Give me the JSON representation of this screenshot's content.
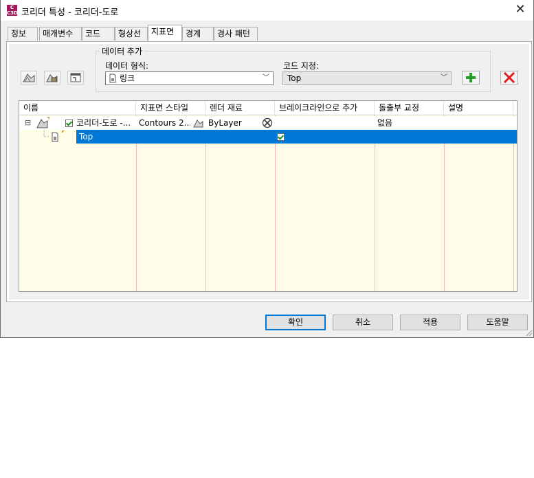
{
  "window": {
    "app_icon_text": "C\nC3D",
    "title": "코리더 특성 - 코리더-도로",
    "close_glyph": "✕"
  },
  "tabs": [
    {
      "label": "정보",
      "active": false
    },
    {
      "label": "매개변수",
      "active": false
    },
    {
      "label": "코드",
      "active": false
    },
    {
      "label": "형상선",
      "active": false
    },
    {
      "label": "지표면",
      "active": true
    },
    {
      "label": "경계",
      "active": false
    },
    {
      "label": "경사 패턴",
      "active": false
    }
  ],
  "toolbar": {
    "icons": [
      "create-surface-icon",
      "add-corridor-surface-icon",
      "surface-properties-icon"
    ]
  },
  "add_data": {
    "group_title": "데이터 추가",
    "data_type_label": "데이터 형식:",
    "data_type_value": "링크",
    "code_label": "코드 지정:",
    "code_value": "Top",
    "add_icon": "plus-icon",
    "remove_icon": "red-x-icon"
  },
  "grid": {
    "columns": [
      "이름",
      "지표면 스타일",
      "렌더 재료",
      "브레이크라인으로 추가",
      "돌출부 교정",
      "설명"
    ],
    "rows": [
      {
        "expand": "⊟",
        "name": "코리더-도로 -...",
        "checked": true,
        "style": "Contours 2...",
        "render": "ByLayer",
        "breakline": "",
        "overhang": "없음",
        "description": ""
      },
      {
        "name": "Top",
        "breakline_checked": true,
        "selected": true
      }
    ]
  },
  "buttons": {
    "ok": "확인",
    "cancel": "취소",
    "apply": "적용",
    "help": "도움말"
  }
}
